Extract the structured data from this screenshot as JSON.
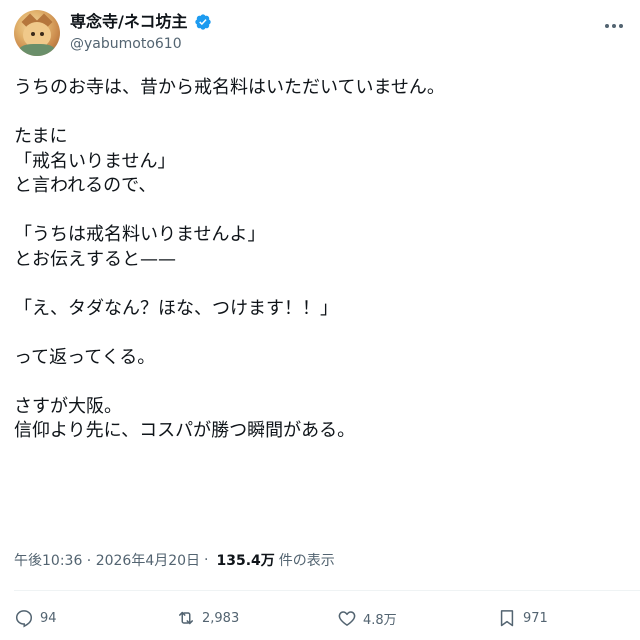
{
  "post": {
    "author": {
      "display_name": "専念寺/ネコ坊主",
      "handle": "@yabumoto610",
      "avatar_icon": "monk-cat-avatar",
      "verified": true
    },
    "text": "うちのお寺は、昔から戒名料はいただいていません。\n\nたまに\n「戒名いりません」\nと言われるので、\n\n「うちは戒名料いりませんよ」\nとお伝えすると——\n\n「え、タダなん？ほな、つけます！！」\n\nって返ってくる。\n\nさすが大阪。\n信仰より先に、コスパが勝つ瞬間がある。",
    "timestamp": "午後10:36 · 2026年4月20日",
    "separator": "·",
    "views_count": "135.4万",
    "views_label": "件の表示"
  },
  "actions": {
    "reply_count": "94",
    "retweet_count": "2,983",
    "like_count": "4.8万",
    "bookmark_count": "971"
  },
  "colors": {
    "text": "#0f1419",
    "secondary": "#536471",
    "verified_blue": "#1d9bf0"
  }
}
